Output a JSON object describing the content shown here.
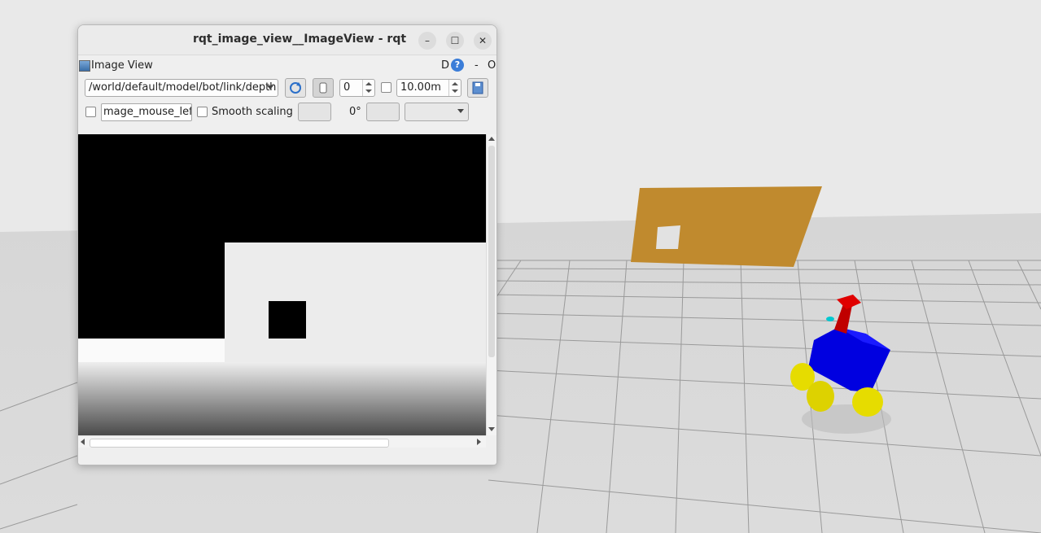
{
  "window": {
    "title": "rqt_image_view__ImageView - rqt",
    "minimize_glyph": "–",
    "maximize_glyph": "☐",
    "close_glyph": "✕"
  },
  "panel": {
    "title": "Image View",
    "d_label": "D",
    "help_glyph": "?",
    "minimize_label": "-",
    "close_label": "O"
  },
  "toolbar": {
    "topic": "/world/default/model/bot/link/depth",
    "refresh_icon": "refresh-icon",
    "zoom_value": "0",
    "max_depth": "10.00m",
    "save_icon": "save-icon"
  },
  "options": {
    "mouse_topic": "mage_mouse_left",
    "smooth_scaling_label": "Smooth scaling",
    "rotation_label": "0°"
  },
  "colors": {
    "floor": "#d9d9d9",
    "sky": "#e9e9e9",
    "wall": "#c08a2e",
    "robot_body": "#0000e0",
    "robot_wheels": "#e6dc00",
    "robot_sensor": "#d40000",
    "window_bg": "#efefef"
  }
}
